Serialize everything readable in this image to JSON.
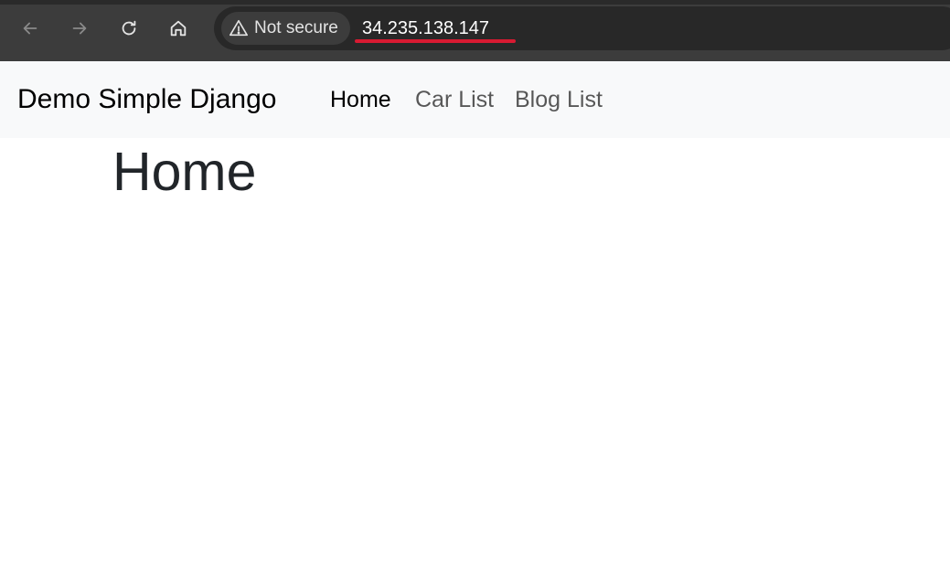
{
  "browser": {
    "security_label": "Not secure",
    "url": "34.235.138.147",
    "icons": {
      "back": "arrow-left-icon",
      "forward": "arrow-right-icon",
      "reload": "reload-icon",
      "home": "home-icon",
      "warning": "warning-triangle-icon"
    },
    "colors": {
      "chrome_bg": "#3c3c3c",
      "omnibox_bg": "#282828",
      "url_underline": "#d81a32"
    }
  },
  "navbar": {
    "brand": "Demo Simple Django",
    "links": [
      {
        "label": "Home",
        "active": true
      },
      {
        "label": "Car List",
        "active": false
      },
      {
        "label": "Blog List",
        "active": false
      }
    ],
    "colors": {
      "background": "#f8f9fa"
    }
  },
  "main": {
    "title": "Home"
  }
}
